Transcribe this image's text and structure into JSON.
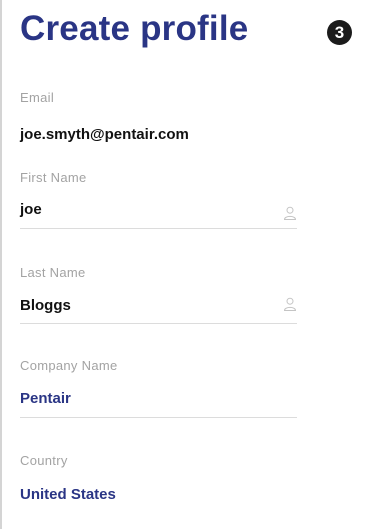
{
  "header": {
    "title": "Create profile",
    "step_number": "3"
  },
  "form": {
    "email": {
      "label": "Email",
      "value": "joe.smyth@pentair.com"
    },
    "first_name": {
      "label": "First Name",
      "value": "joe",
      "icon": "person-icon"
    },
    "last_name": {
      "label": "Last Name",
      "value": "Bloggs",
      "icon": "person-icon"
    },
    "company_name": {
      "label": "Company Name",
      "value": "Pentair"
    },
    "country": {
      "label": "Country",
      "value": "United States"
    }
  },
  "colors": {
    "accent": "#2a3585",
    "label": "#a3a3a3",
    "value": "#111111",
    "underline": "#dcdcdc"
  }
}
